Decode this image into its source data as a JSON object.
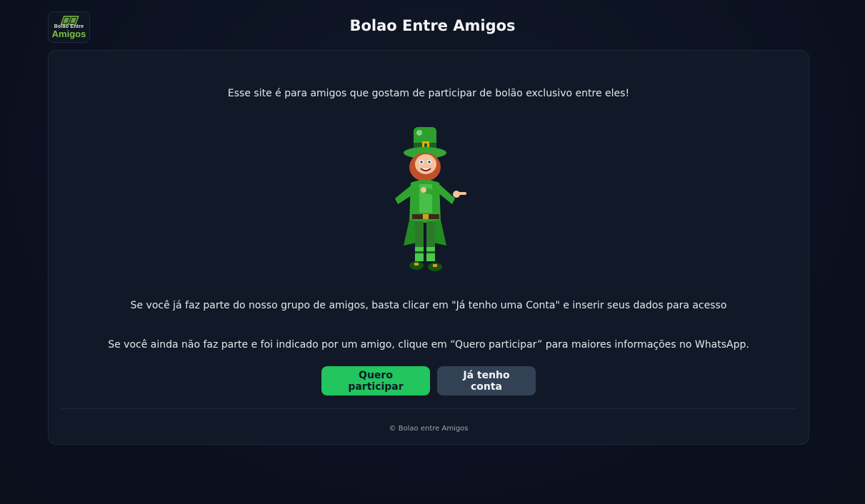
{
  "header": {
    "logo_line1": "Bolão  Entre",
    "logo_line2": "Amigos",
    "title": "Bolao Entre Amigos"
  },
  "main": {
    "intro": "Esse site é para amigos que gostam de participar de bolão exclusivo entre eles!",
    "existing_member_text": "Se você já faz parte do nosso grupo de amigos, basta clicar em \"Já tenho uma Conta\" e inserir seus dados para acesso",
    "new_member_text": "Se você ainda não faz parte e foi indicado por um amigo, clique em “Quero participar” para maiores informações no WhatsApp.",
    "buttons": {
      "join_label": "Quero participar",
      "login_label": "Já tenho conta"
    }
  },
  "footer": {
    "copyright": "© Bolao entre Amigos"
  },
  "colors": {
    "background": "#0b1120",
    "card": "#111827",
    "primary": "#22c55e",
    "secondary": "#334155",
    "brand_green": "#7bc043"
  },
  "icons": {
    "logo": "soccer-field-logo",
    "mascot": "leprechaun-mascot"
  }
}
